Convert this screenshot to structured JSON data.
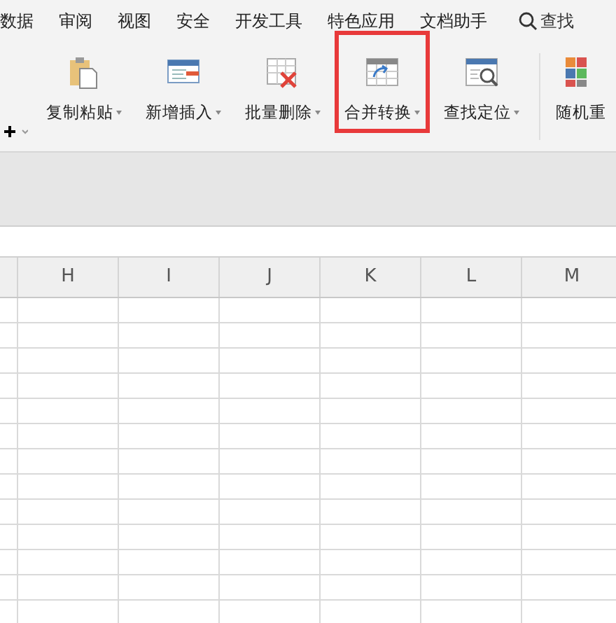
{
  "menu_tabs": [
    {
      "label": "数据"
    },
    {
      "label": "审阅"
    },
    {
      "label": "视图"
    },
    {
      "label": "安全"
    },
    {
      "label": "开发工具"
    },
    {
      "label": "特色应用"
    },
    {
      "label": "文档助手"
    }
  ],
  "search": {
    "label": "查找"
  },
  "ribbon": {
    "tools": [
      {
        "kind": "clipboard",
        "label": "复制粘贴",
        "dropdown": true,
        "highlighted": false
      },
      {
        "kind": "insert",
        "label": "新增插入",
        "dropdown": true,
        "highlighted": false
      },
      {
        "kind": "delete",
        "label": "批量删除",
        "dropdown": true,
        "highlighted": false
      },
      {
        "kind": "merge",
        "label": "合并转换",
        "dropdown": true,
        "highlighted": true
      },
      {
        "kind": "find",
        "label": "查找定位",
        "dropdown": true,
        "highlighted": false
      },
      {
        "kind": "random",
        "label": "随机重",
        "dropdown": false,
        "highlighted": false
      }
    ]
  },
  "sheet": {
    "columns": [
      "H",
      "I",
      "J",
      "K",
      "L",
      "M"
    ]
  }
}
